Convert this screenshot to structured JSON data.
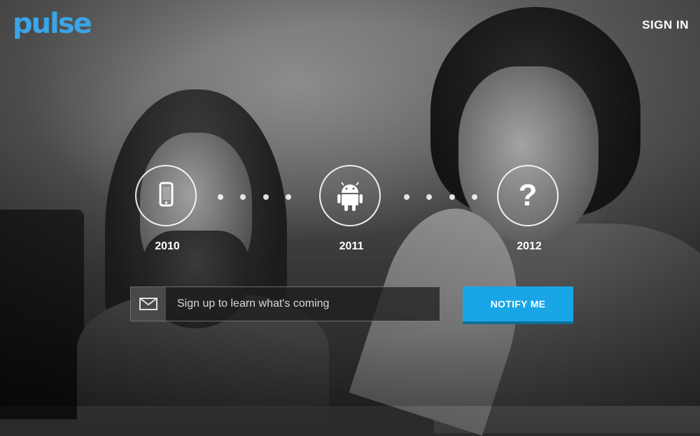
{
  "header": {
    "logo_text": "pulse",
    "sign_in_label": "SIGN IN"
  },
  "timeline": {
    "stages": [
      {
        "year": "2010",
        "icon": "phone-icon"
      },
      {
        "year": "2011",
        "icon": "android-icon"
      },
      {
        "year": "2012",
        "icon": "question-mark-icon",
        "symbol": "?"
      }
    ]
  },
  "signup": {
    "placeholder": "Sign up to learn what's coming",
    "button_label": "NOTIFY ME",
    "icon": "envelope-icon"
  },
  "colors": {
    "brand": "#3ba5e8",
    "button": "#19a6e6"
  }
}
